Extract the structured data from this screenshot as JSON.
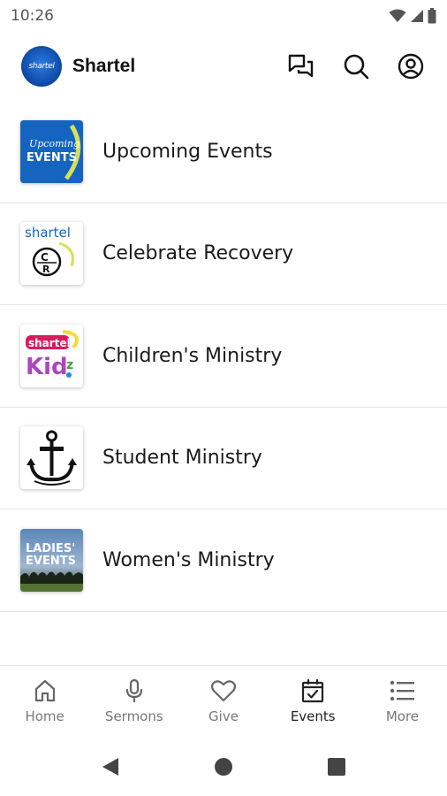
{
  "status_bar": {
    "time": "10:26",
    "icons": [
      "wifi-icon",
      "signal-icon",
      "battery-icon"
    ]
  },
  "header": {
    "logo_text": "shartel",
    "title": "Shartel",
    "actions": [
      "chat-icon",
      "search-icon",
      "account-icon"
    ]
  },
  "events": [
    {
      "label": "Upcoming Events",
      "thumb_text": "Upcoming EVENTS",
      "thumb_color": "#1565c0"
    },
    {
      "label": "Celebrate Recovery",
      "thumb_text": "shartel",
      "thumb_color": "#ffffff"
    },
    {
      "label": "Children's Ministry",
      "thumb_text": "shartel Kidz",
      "thumb_color": "#ffffff"
    },
    {
      "label": "Student Ministry",
      "thumb_text": "",
      "thumb_color": "#ffffff"
    },
    {
      "label": "Women's Ministry",
      "thumb_text": "LADIES' EVENTS",
      "thumb_color": "#3b5f8a"
    }
  ],
  "bottom_nav": [
    {
      "label": "Home",
      "icon": "home-icon",
      "active": false
    },
    {
      "label": "Sermons",
      "icon": "microphone-icon",
      "active": false
    },
    {
      "label": "Give",
      "icon": "heart-icon",
      "active": false
    },
    {
      "label": "Events",
      "icon": "calendar-check-icon",
      "active": true
    },
    {
      "label": "More",
      "icon": "list-icon",
      "active": false
    }
  ],
  "colors": {
    "brand_blue": "#0d47a1",
    "text_primary": "#1a1a1a",
    "nav_inactive": "#777777",
    "divider": "#e6e6e6"
  }
}
